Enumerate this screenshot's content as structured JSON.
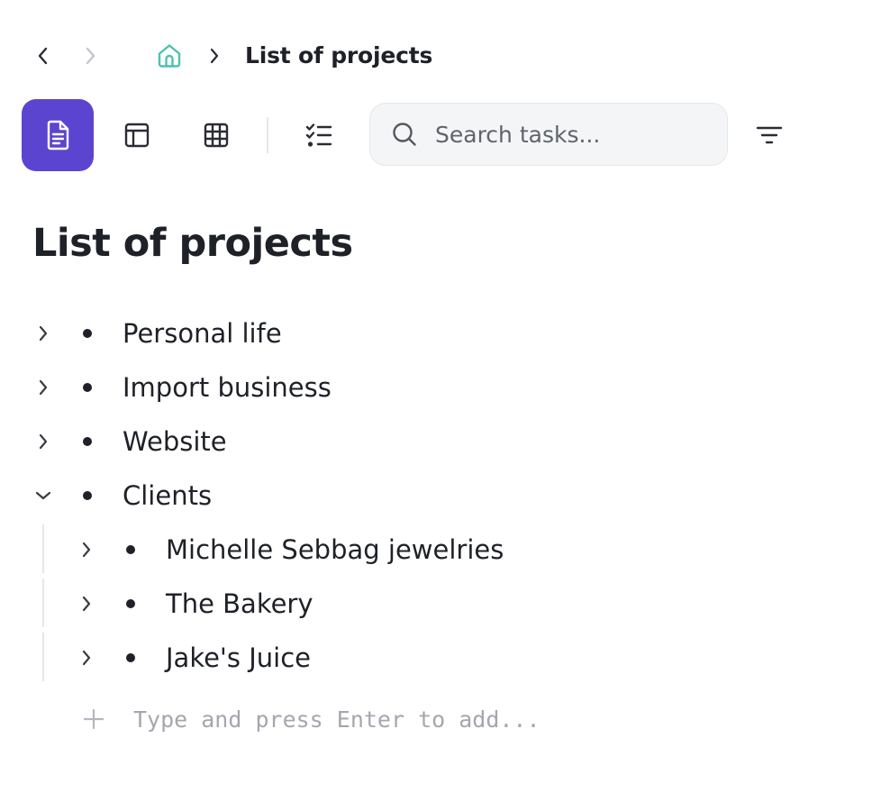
{
  "breadcrumb": {
    "current": "List of projects"
  },
  "toolbar": {
    "views": [
      "document-view",
      "board-view",
      "table-view",
      "tasks-view"
    ],
    "active_view": "document-view",
    "accent_color": "#5b45d0"
  },
  "search": {
    "placeholder": "Search tasks..."
  },
  "page": {
    "title": "List of projects"
  },
  "tree": {
    "items": [
      {
        "label": "Personal life",
        "expanded": false,
        "depth": 0
      },
      {
        "label": "Import business",
        "expanded": false,
        "depth": 0
      },
      {
        "label": "Website",
        "expanded": false,
        "depth": 0
      },
      {
        "label": "Clients",
        "expanded": true,
        "depth": 0
      },
      {
        "label": "Michelle Sebbag jewelries",
        "expanded": false,
        "depth": 1
      },
      {
        "label": "The Bakery",
        "expanded": false,
        "depth": 1
      },
      {
        "label": "Jake's Juice",
        "expanded": false,
        "depth": 1
      }
    ]
  },
  "add_item": {
    "placeholder": "Type and press Enter to add..."
  }
}
